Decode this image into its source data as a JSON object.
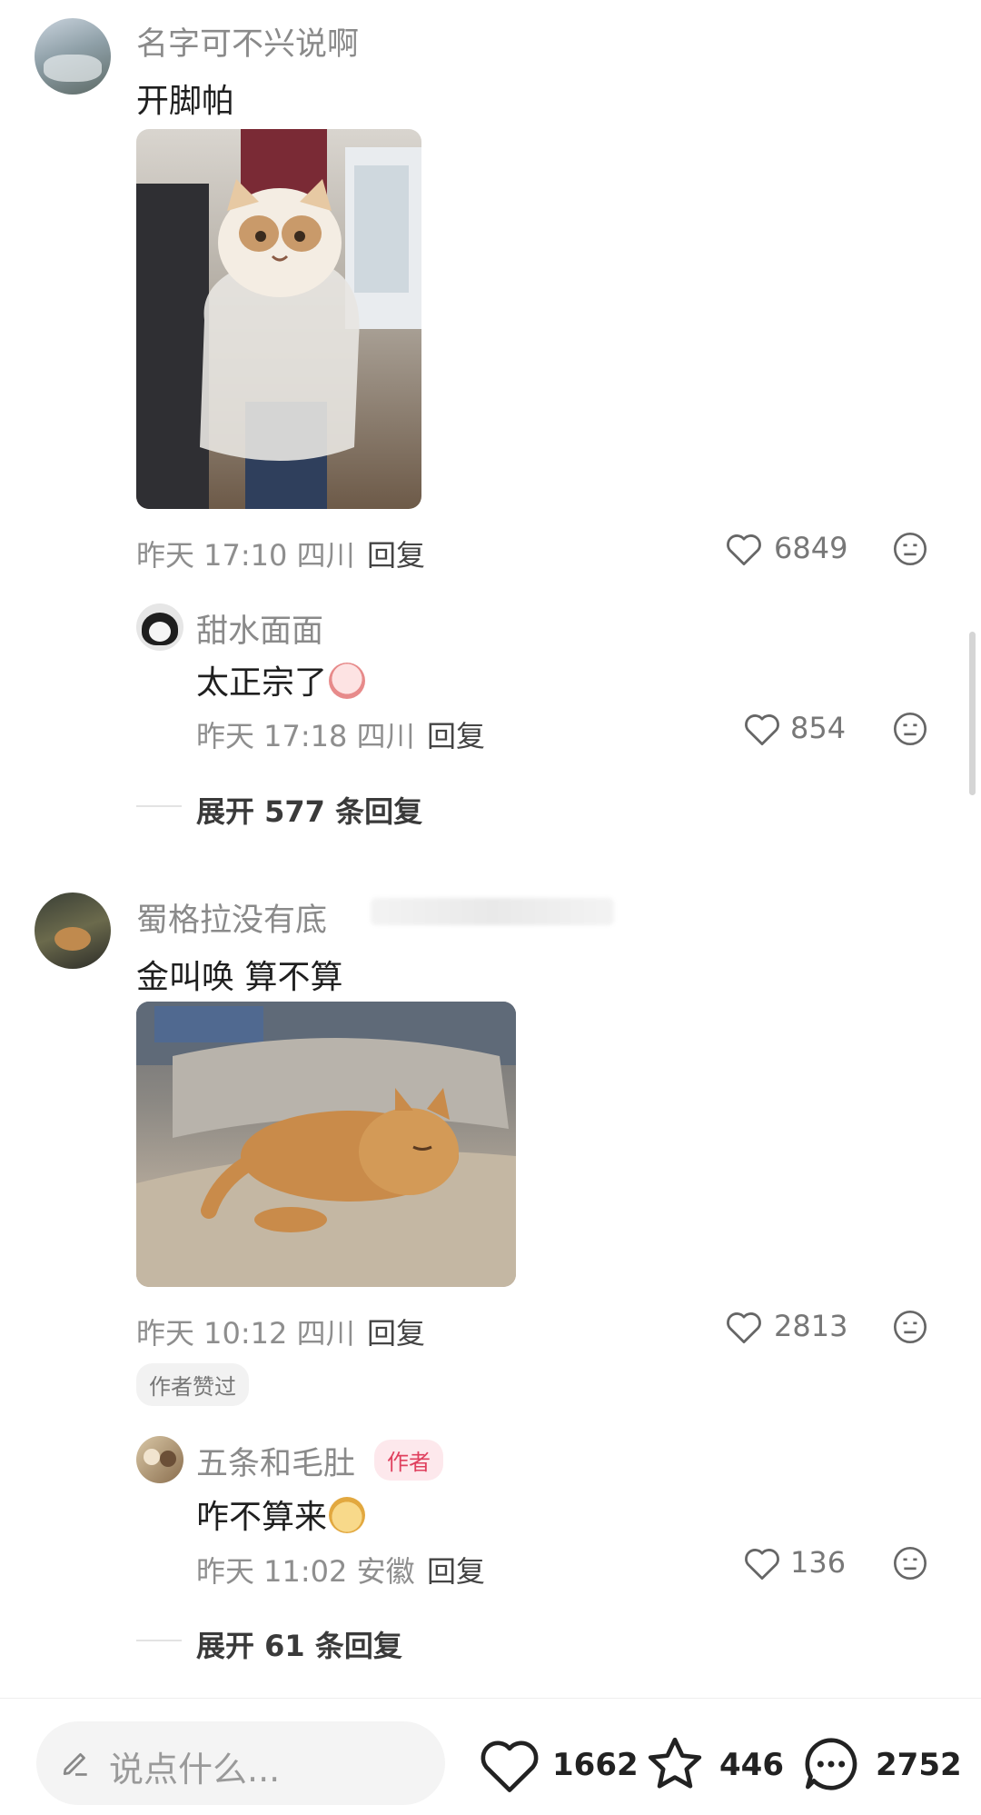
{
  "comments": [
    {
      "user": "名字可不兴说啊",
      "text": "开脚帕",
      "time": "昨天 17:10 四川",
      "reply_label": "回复",
      "likes": "6849",
      "reply": {
        "user": "甜水面面",
        "text": "太正宗了",
        "time": "昨天 17:18 四川",
        "reply_label": "回复",
        "likes": "854"
      },
      "expand": "展开 577 条回复"
    },
    {
      "user": "蜀格拉没有底",
      "text": "金叫唤 算不算",
      "time": "昨天 10:12 四川",
      "reply_label": "回复",
      "likes": "2813",
      "badge": "作者赞过",
      "reply": {
        "user": "五条和毛肚",
        "author_badge": "作者",
        "text": "咋不算来",
        "time": "昨天 11:02 安徽",
        "reply_label": "回复",
        "likes": "136"
      },
      "expand": "展开 61 条回复"
    }
  ],
  "bottom_bar": {
    "placeholder": "说点什么...",
    "likes": "1662",
    "favorites": "446",
    "comments": "2752"
  },
  "icons": [
    "avatar",
    "heart-icon",
    "dislike-face-icon",
    "pencil-icon",
    "star-icon",
    "chat-icon"
  ],
  "colors": {
    "author_badge": "#e0405e",
    "muted_text": "#8e8e8e"
  }
}
